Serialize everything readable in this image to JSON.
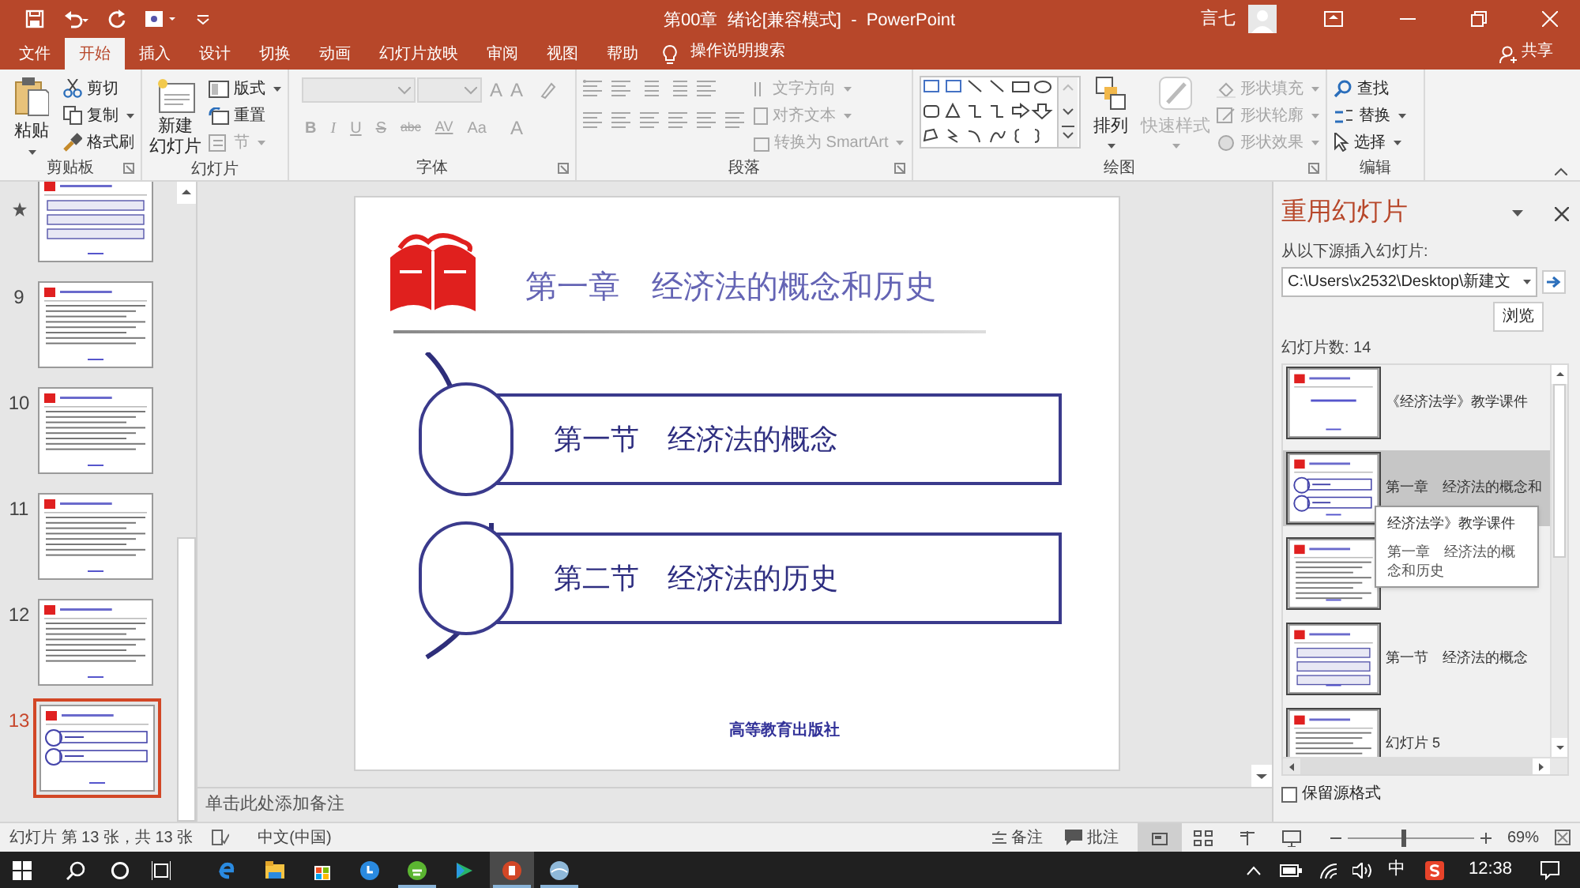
{
  "window": {
    "title": "第00章  绪论[兼容模式]  -  PowerPoint",
    "user": "言七"
  },
  "tabs": [
    {
      "label": "文件",
      "selected": false
    },
    {
      "label": "开始",
      "selected": true
    },
    {
      "label": "插入",
      "selected": false
    },
    {
      "label": "设计",
      "selected": false
    },
    {
      "label": "切换",
      "selected": false
    },
    {
      "label": "动画",
      "selected": false
    },
    {
      "label": "幻灯片放映",
      "selected": false
    },
    {
      "label": "审阅",
      "selected": false
    },
    {
      "label": "视图",
      "selected": false
    },
    {
      "label": "帮助",
      "selected": false
    }
  ],
  "search": {
    "placeholder": "操作说明搜索"
  },
  "share": "共享",
  "ribbon": {
    "clipboard": {
      "label": "剪贴板",
      "paste": "粘贴",
      "items": [
        "剪切",
        "复制",
        "格式刷"
      ]
    },
    "slides": {
      "label": "幻灯片",
      "new_slide": [
        "新建",
        "幻灯片"
      ],
      "items": [
        {
          "label": "版式",
          "disabled": false
        },
        {
          "label": "重置",
          "disabled": false
        },
        {
          "label": "节",
          "disabled": true
        }
      ]
    },
    "font": {
      "label": "字体",
      "disabled": true,
      "size_buttons": [
        "A",
        "A"
      ],
      "format_buttons": [
        "B",
        "I",
        "U",
        "S",
        "abc",
        "AV",
        "Aa",
        "A"
      ]
    },
    "paragraph": {
      "label": "段落",
      "items": [
        {
          "label": "文字方向",
          "disabled": true
        },
        {
          "label": "对齐文本",
          "disabled": true
        },
        {
          "label": "转换为 SmartArt",
          "disabled": true
        }
      ]
    },
    "drawing": {
      "label": "绘图",
      "arrange": "排列",
      "quick_styles": {
        "label": "快速样式",
        "disabled": true
      },
      "items": [
        {
          "label": "形状填充",
          "disabled": true
        },
        {
          "label": "形状轮廓",
          "disabled": true
        },
        {
          "label": "形状效果",
          "disabled": true
        }
      ]
    },
    "editing": {
      "label": "编辑",
      "items": [
        "查找",
        "替换",
        "选择"
      ]
    }
  },
  "thumbnails": [
    {
      "animated": true,
      "kind": "boxes",
      "selected": false
    },
    {
      "number": "9",
      "animated": false,
      "kind": "text",
      "selected": false
    },
    {
      "number": "10",
      "animated": false,
      "kind": "text",
      "selected": false
    },
    {
      "number": "11",
      "animated": false,
      "kind": "text",
      "selected": false
    },
    {
      "number": "12",
      "animated": false,
      "kind": "text",
      "selected": false
    },
    {
      "number": "13",
      "animated": false,
      "kind": "sections",
      "selected": true
    }
  ],
  "slide": {
    "title": "第一章　经济法的概念和历史",
    "sections": [
      "第一节　经济法的概念",
      "第二节　经济法的历史"
    ],
    "footer": "高等教育出版社"
  },
  "notes": {
    "placeholder": "单击此处添加备注"
  },
  "reuse_panel": {
    "title": "重用幻灯片",
    "source_label": "从以下源插入幻灯片:",
    "source": "C:\\Users\\x2532\\Desktop\\新建文",
    "browse": "浏览",
    "count": "幻灯片数: 14",
    "items": [
      {
        "label": "《经济法学》教学课件",
        "kind": "title",
        "selected": false
      },
      {
        "label": "第一章　经济法的概念和",
        "kind": "sections",
        "selected": true
      },
      {
        "kind": "text",
        "selected": false
      },
      {
        "label": "第一节　经济法的概念",
        "kind": "boxes",
        "selected": false
      },
      {
        "label": "幻灯片 5",
        "kind": "text",
        "selected": false
      }
    ],
    "tooltip": {
      "title": "经济法学》教学课件",
      "body": "第一章　经济法的概念和历史"
    },
    "keep_format": {
      "label": "保留源格式",
      "checked": false
    }
  },
  "status_bar": {
    "slide_info": "幻灯片 第 13 张，共 13 张",
    "language": "中文(中国)",
    "notes": "备注",
    "comments": "批注",
    "views": [
      {
        "selected": true
      },
      {
        "selected": false
      },
      {
        "selected": false
      },
      {
        "selected": false
      }
    ],
    "zoom_slider": {
      "level": 0.42
    },
    "zoom": "69%"
  },
  "taskbar": {
    "apps": [
      {
        "running": false,
        "selected": false
      },
      {
        "running": false,
        "selected": false
      },
      {
        "running": false,
        "selected": false
      },
      {
        "running": false,
        "selected": false
      },
      {
        "running": true,
        "selected": false
      },
      {
        "running": false,
        "selected": false
      },
      {
        "running": true,
        "selected": true
      },
      {
        "running": true,
        "selected": false
      }
    ],
    "ime": "中",
    "time": "12:38"
  }
}
